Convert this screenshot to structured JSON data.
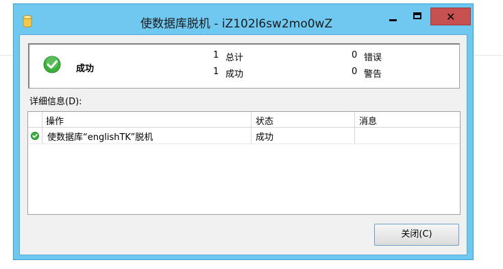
{
  "window": {
    "title": "使数据库脱机 - iZ102l6sw2mo0wZ",
    "close_glyph": "✕"
  },
  "summary": {
    "status": "成功",
    "total_count": "1",
    "total_label": "总计",
    "success_count": "1",
    "success_label": "成功",
    "error_count": "0",
    "error_label": "错误",
    "warning_count": "0",
    "warning_label": "警告"
  },
  "details": {
    "label": "详细信息(D):",
    "columns": [
      "操作",
      "状态",
      "消息"
    ],
    "rows": [
      {
        "action": "使数据库“englishTK”脱机",
        "status": "成功",
        "message": ""
      }
    ]
  },
  "footer": {
    "close_label": "关闭(C)"
  },
  "colors": {
    "titlebar": "#6ec8f0",
    "close_button": "#c75050",
    "success_icon": "#3cae3c"
  }
}
